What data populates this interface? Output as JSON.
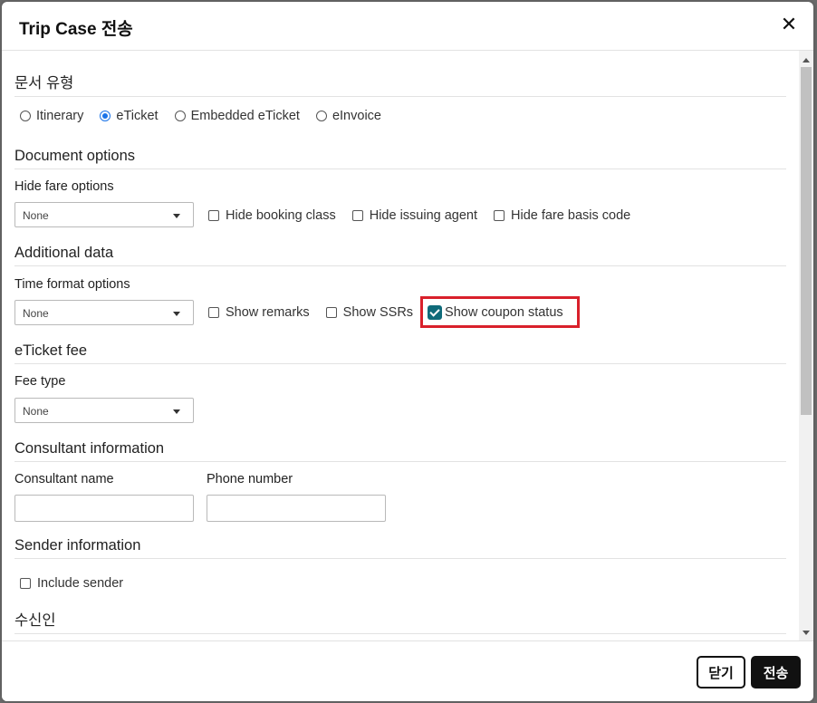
{
  "dialog": {
    "title": "Trip Case 전송",
    "close_icon": "close-icon"
  },
  "document_type": {
    "title": "문서 유형",
    "options": [
      {
        "label": "Itinerary",
        "checked": false
      },
      {
        "label": "eTicket",
        "checked": true
      },
      {
        "label": "Embedded eTicket",
        "checked": false
      },
      {
        "label": "eInvoice",
        "checked": false
      }
    ]
  },
  "document_options": {
    "title": "Document options",
    "hide_fare_label": "Hide fare options",
    "hide_fare_value": "None",
    "checkboxes": [
      {
        "label": "Hide booking class",
        "checked": false
      },
      {
        "label": "Hide issuing agent",
        "checked": false
      },
      {
        "label": "Hide fare basis code",
        "checked": false
      }
    ]
  },
  "additional_data": {
    "title": "Additional data",
    "time_format_label": "Time format options",
    "time_format_value": "None",
    "checkboxes": [
      {
        "label": "Show remarks",
        "checked": false
      },
      {
        "label": "Show SSRs",
        "checked": false
      },
      {
        "label": "Show coupon status",
        "checked": true
      }
    ]
  },
  "eticket_fee": {
    "title": "eTicket fee",
    "fee_type_label": "Fee type",
    "fee_type_value": "None"
  },
  "consultant": {
    "title": "Consultant information",
    "name_label": "Consultant name",
    "name_value": "",
    "phone_label": "Phone number",
    "phone_value": ""
  },
  "sender": {
    "title": "Sender information",
    "include_label": "Include sender",
    "include_checked": false
  },
  "recipient": {
    "title": "수신인"
  },
  "footer": {
    "close_label": "닫기",
    "send_label": "전송"
  },
  "colors": {
    "highlight": "#d9202b",
    "checked_box": "#0f6b7a",
    "radio_accent": "#1a73e8"
  }
}
